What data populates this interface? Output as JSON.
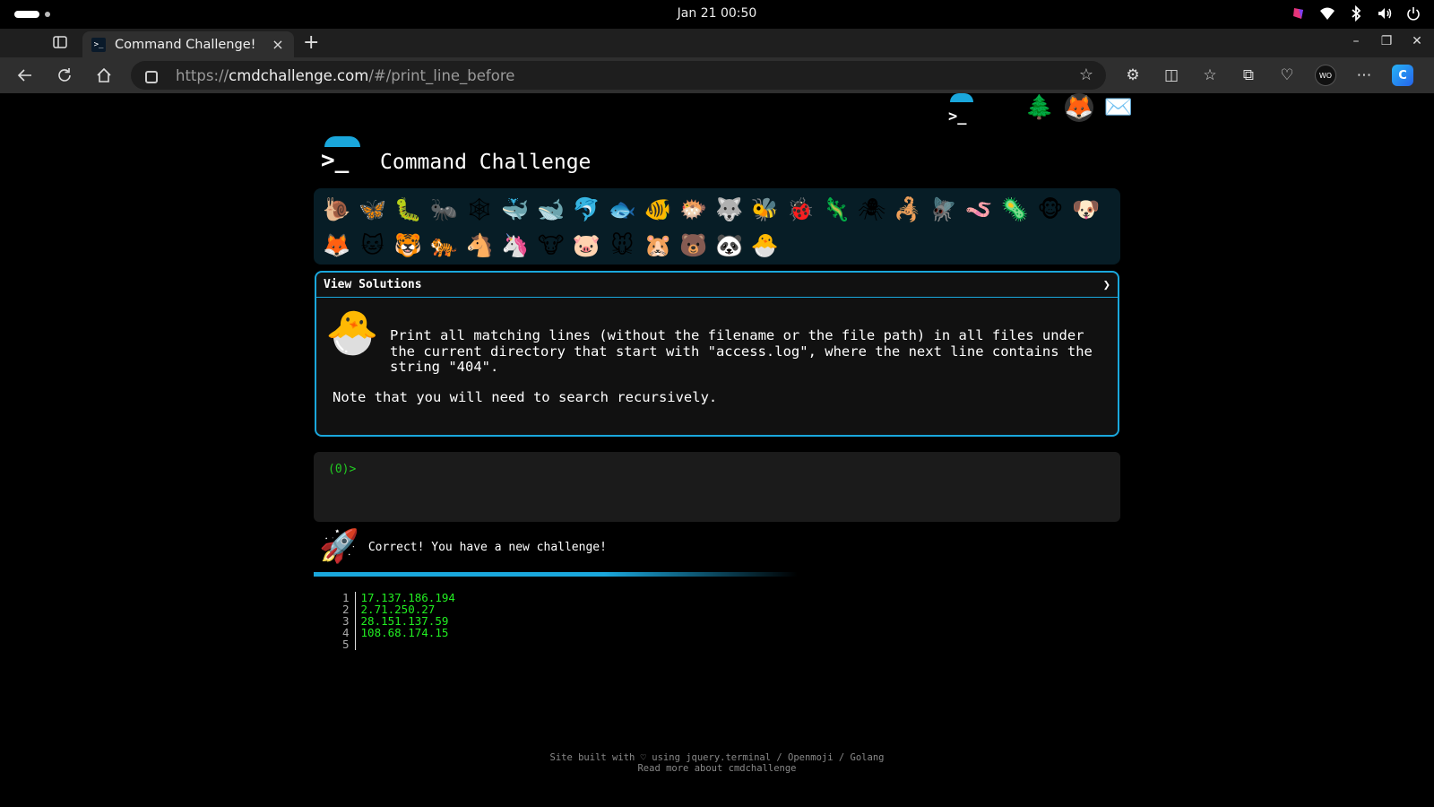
{
  "os": {
    "clock": "Jan 21  00:50",
    "tray": [
      "app-icon",
      "wifi-icon",
      "bluetooth-icon",
      "volume-icon",
      "power-icon"
    ]
  },
  "browser": {
    "tab_title": "Command Challenge!",
    "tab_close": "×",
    "new_tab": "+",
    "url_scheme": "https://",
    "url_host": "cmdchallenge.com",
    "url_path": "/#/print_line_before",
    "star": "☆"
  },
  "page": {
    "top_icons": [
      "prompt-logo",
      "😮",
      "🌲",
      "🦊",
      "✉️"
    ],
    "title": "Command Challenge",
    "levels": [
      "🐌",
      "🦋",
      "🐛",
      "🐜",
      "🕸",
      "🐳",
      "🐋",
      "🐬",
      "🐟",
      "🐠",
      "🐡",
      "🐺",
      "🐝",
      "🐞",
      "🦎",
      "🕷",
      "🦂",
      "🪰",
      "🪱",
      "🦠",
      "🐵",
      "🐶",
      "🦊",
      "🐱",
      "🐯",
      "🐅",
      "🐴",
      "🦄",
      "🐮",
      "🐷",
      "🐭",
      "🐹",
      "🐻",
      "🐼",
      "🐣"
    ],
    "solutions_label": "View Solutions",
    "solutions_chevron": "❯",
    "challenge_icon": "🐣",
    "challenge_text": "Print all matching lines (without the filename or the file path) in all files under the current directory that start with \"access.log\", where the next line contains the string \"404\".",
    "challenge_note": "Note that you will need to search recursively.",
    "terminal_prompt": "(0)>",
    "result_icon": "🚀",
    "result_text": "Correct! You have a new challenge!",
    "output_line_numbers": [
      "1",
      "2",
      "3",
      "4",
      "5"
    ],
    "output_lines": [
      "17.137.186.194",
      "2.71.250.27",
      "28.151.137.59",
      "108.68.174.15",
      ""
    ],
    "footer_line1": "Site built with ♡ using jquery.terminal / Openmoji / Golang",
    "footer_line2": "Read more about cmdchallenge"
  },
  "colors": {
    "accent": "#1aa7dc",
    "terminal_green": "#22cc22",
    "panel_bg": "#071d26"
  }
}
